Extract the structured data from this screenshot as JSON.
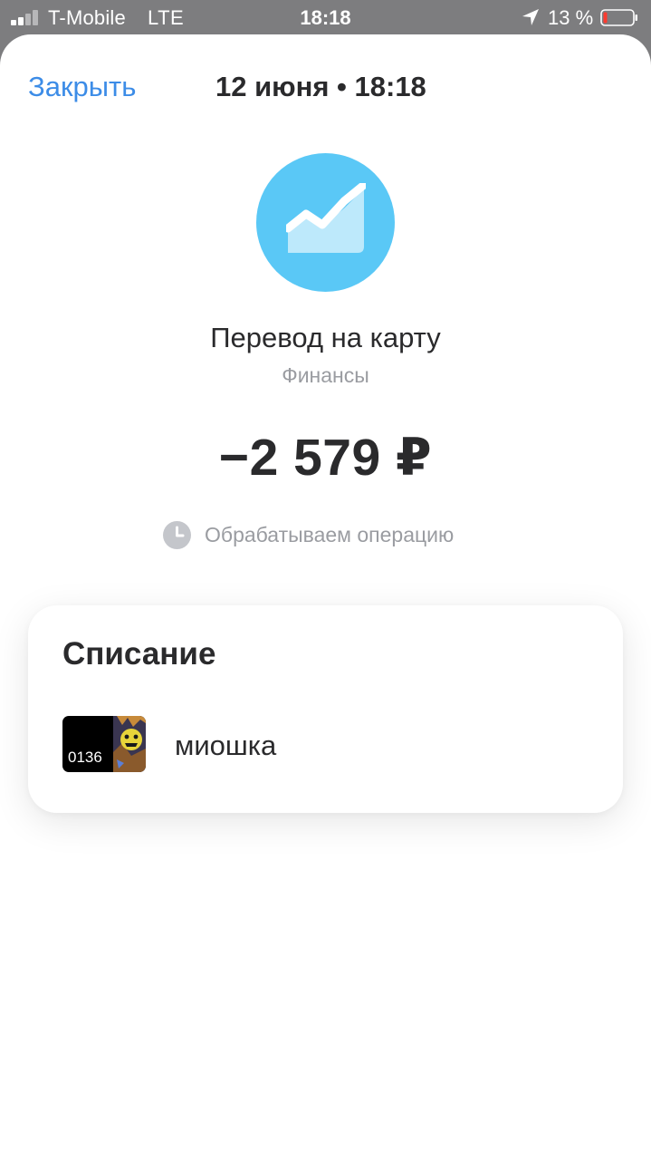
{
  "status_bar": {
    "carrier": "T-Mobile",
    "network": "LTE",
    "time": "18:18",
    "battery": "13 %",
    "icons": [
      "signal-icon",
      "location-arrow-icon",
      "battery-low-icon"
    ]
  },
  "header": {
    "close_label": "Закрыть",
    "datetime": "12 июня • 18:18"
  },
  "operation": {
    "icon": "chart-up-icon",
    "icon_color": "#5ac8f6",
    "title": "Перевод на карту",
    "category": "Финансы",
    "amount": "−2 579 ₽",
    "status_icon": "clock-icon",
    "status": "Обрабатываем операцию"
  },
  "debit": {
    "heading": "Списание",
    "card_last_digits": "0136",
    "account_name": "миошка"
  },
  "colors": {
    "accent": "#3c8ce7",
    "text": "#2a2a2c",
    "secondary": "#9a9ca1",
    "battery_low": "#ff3b30"
  }
}
